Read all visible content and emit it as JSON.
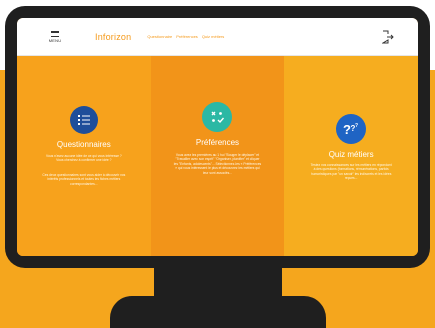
{
  "app": {
    "logo": "Inforizon",
    "menu_label": "MENU"
  },
  "nav": {
    "links": [
      "Questionnaire",
      "Préférences",
      "Quiz métiers"
    ]
  },
  "icons": {
    "menu": "hamburger-icon",
    "logout": "logout-icon",
    "questionnaire": "list-icon",
    "preferences": "smiley-icon",
    "quiz": "question-marks-icon"
  },
  "panels": [
    {
      "title": "Questionnaires",
      "paragraphs": [
        "Vous n'avez aucune idée de ce qui vous intéresse ? Vous cherchez à confirmer une idée ?",
        "Ces deux questionnaires sont vous aider à découvrir vos intérêts professionnels et toutes les fiches métiers correspondantes..."
      ],
      "icon_color": "#1f4e9a"
    },
    {
      "title": "Préférences",
      "paragraphs": [
        "Vous avez les premières au 1 hui \"Bouger le déplacer\" et \"Travailler avec son esprit\" \"Organiser, planifier\" et cliquer les \"Enfants, adolescents\"... Sélectionnez-les « Préférences » qui vous intéressent le plus et découvrez les métiers qui leur sont associés..."
      ],
      "icon_color": "#2bb8a4"
    },
    {
      "title": "Quiz métiers",
      "paragraphs": [
        "Testez vos connaissances sur les métiers en répondant à des questions (formations, rémunérations, parfois humoristiques par \"un savoir\" les indiscrets et les idées reçues..."
      ],
      "icon_color": "#1f64c4"
    }
  ]
}
